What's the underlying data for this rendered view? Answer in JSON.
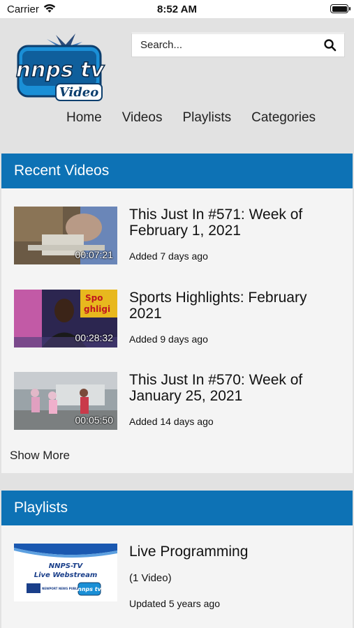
{
  "status_bar": {
    "carrier": "Carrier",
    "time": "8:52 AM"
  },
  "header": {
    "logo_text": "nnps tv",
    "logo_sub": "Video",
    "search": {
      "placeholder": "Search..."
    },
    "nav": [
      "Home",
      "Videos",
      "Playlists",
      "Categories"
    ]
  },
  "recent": {
    "heading": "Recent Videos",
    "videos": [
      {
        "title": "This Just In #571: Week of February 1, 2021",
        "duration": "00:07:21",
        "added": "Added 7 days ago"
      },
      {
        "title": "Sports Highlights: February 2021",
        "duration": "00:28:32",
        "added": "Added 9 days ago"
      },
      {
        "title": "This Just In #570: Week of January 25, 2021",
        "duration": "00:05:50",
        "added": "Added 14 days ago"
      }
    ],
    "show_more": "Show More"
  },
  "playlists": {
    "heading": "Playlists",
    "items": [
      {
        "title": "Live Programming",
        "count": "(1 Video)",
        "updated": "Updated 5 years ago",
        "thumb_line1": "NNPS-TV",
        "thumb_line2": "Live Webstream",
        "thumb_org": "NEWPORT NEWS PUBLIC SCHOOLS",
        "thumb_logo": "nnps tv"
      }
    ]
  },
  "colors": {
    "accent": "#0d72b5",
    "background": "#e2e2e2",
    "panel": "#f4f4f4"
  }
}
